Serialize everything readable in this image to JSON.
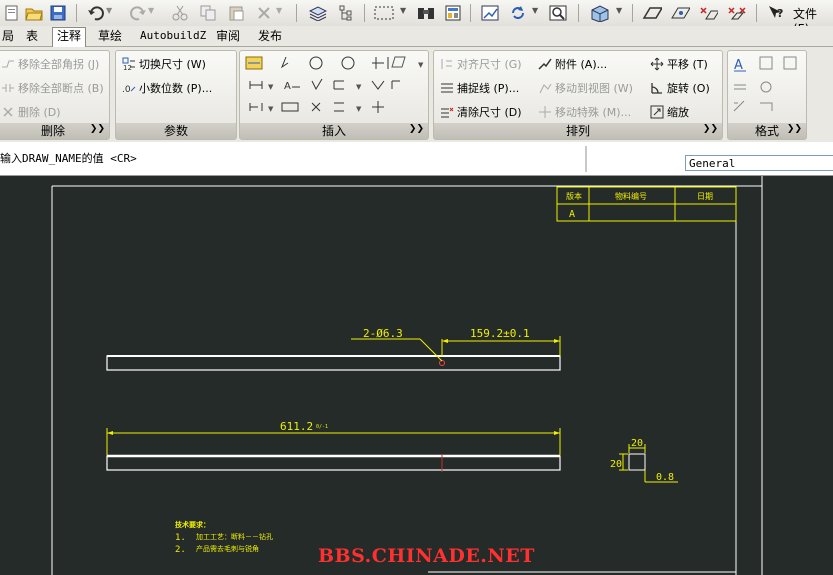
{
  "quick_access": {
    "file_label": "文件 (F)",
    "icons": [
      "new-icon",
      "open-icon",
      "save-icon",
      "undo-icon",
      "redo-icon",
      "cut-icon",
      "copy-icon",
      "paste-icon",
      "erase-icon",
      "layers-icon",
      "tree-icon",
      "select-window-icon",
      "binoculars-icon",
      "properties-icon",
      "viewport-icon",
      "refresh-icon",
      "zoom-icon",
      "box-icon",
      "eraser-icon",
      "eye-icon",
      "xeye-icon",
      "xeye2-icon",
      "help-icon"
    ]
  },
  "tabs": [
    {
      "label": "局"
    },
    {
      "label": "表"
    },
    {
      "label": "注释",
      "active": true
    },
    {
      "label": "草绘"
    },
    {
      "label": "AutobuildZ"
    },
    {
      "label": "审阅"
    },
    {
      "label": "发布"
    }
  ],
  "ribbon": {
    "delete_panel": {
      "title": "删除",
      "items": [
        "移除全部角拐 (J)",
        "移除全部断点 (B)",
        "删除 (D)"
      ]
    },
    "params_panel": {
      "title": "参数",
      "items": [
        "切换尺寸 (W)",
        "小数位数 (P)..."
      ]
    },
    "insert_panel": {
      "title": "插入"
    },
    "arrange_panel": {
      "title": "排列",
      "items": [
        "对齐尺寸 (G)",
        "附件 (A)...",
        "平移 (T)",
        "捕捉线 (P)...",
        "移动到视图 (W)",
        "旋转 (O)",
        "清除尺寸 (D)",
        "移动特殊 (M)...",
        "缩放"
      ]
    },
    "format_panel": {
      "title": "格式"
    }
  },
  "command_line": {
    "prompt": "输入DRAW_NAME的值    <CR>",
    "style_value": "General"
  },
  "drawing": {
    "title_block": {
      "col1": "版本",
      "col2": "物料编号",
      "col3": "日期",
      "row1": "A"
    },
    "dim_hole": "2-Ø6.3",
    "dim_length": "159.2±0.1",
    "dim_total": "611.2",
    "dim_tol": "0/-1",
    "dim_top": "20",
    "dim_side": "20",
    "dim_wall": "0.8",
    "notes_title": "技术要求：",
    "note1_num": "1.",
    "note1": "加工工艺：断料－－钻孔",
    "note2_num": "2.",
    "note2": "产品需去毛刺与锐角"
  },
  "watermark": "BBS.CHINADE.NET"
}
